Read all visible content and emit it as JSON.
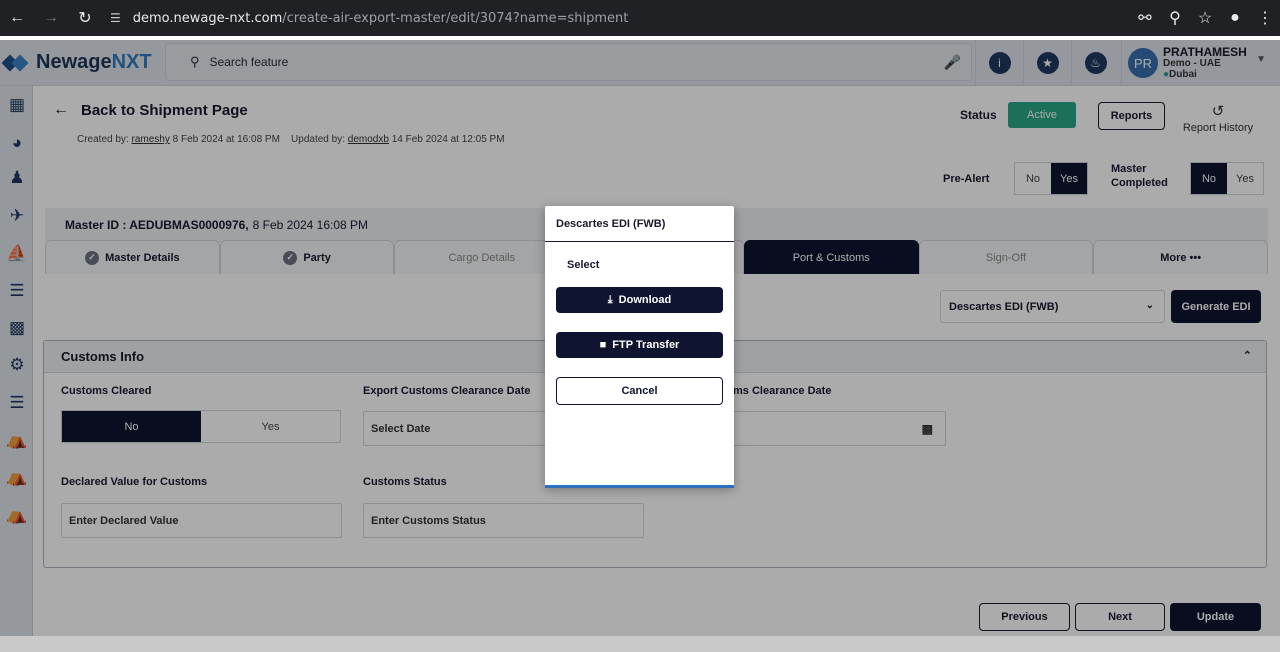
{
  "browser": {
    "host": "demo.newage-nxt.com",
    "path": "/create-air-export-master/edit/3074?name=shipment"
  },
  "app": {
    "brand_a": "Newage",
    "brand_b": "NXT",
    "search_placeholder": "Search feature",
    "user": {
      "initials": "PR",
      "name": "PRATHAMESH",
      "company": "Demo - UAE",
      "location": "Dubai"
    }
  },
  "page": {
    "back_label": "Back to Shipment Page",
    "created_prefix": "Created by:",
    "created_user": "rameshy",
    "created_date": "8 Feb 2024 at 16:08 PM",
    "updated_prefix": "Updated by:",
    "updated_user": "demodxb",
    "updated_date": "14 Feb 2024 at 12:05 PM",
    "status_label": "Status",
    "status_value": "Active",
    "reports_label": "Reports",
    "report_history_label": "Report History",
    "prealert_label": "Pre-Alert",
    "master_completed_label": "Master Completed",
    "no": "No",
    "yes": "Yes",
    "master_id_label": "Master ID : AEDUBMAS0000976,",
    "master_id_date": "8 Feb 2024 16:08 PM"
  },
  "tabs": [
    {
      "label": "Master Details"
    },
    {
      "label": "Party"
    },
    {
      "label": "Cargo Details"
    },
    {
      "label": ""
    },
    {
      "label": "Port & Customs"
    },
    {
      "label": "Sign-Off"
    },
    {
      "label": "More •••"
    }
  ],
  "edi": {
    "selected": "Descartes EDI (FWB)",
    "generate_label": "Generate EDI"
  },
  "customs": {
    "title": "Customs Info",
    "cleared_label": "Customs Cleared",
    "export_date_label": "Export Customs Clearance Date",
    "export_date_placeholder": "Select Date",
    "import_date_label": "ms Clearance Date",
    "declared_label": "Declared Value for Customs",
    "declared_placeholder": "Enter Declared Value",
    "status_label": "Customs Status",
    "status_placeholder": "Enter Customs Status"
  },
  "footer": {
    "previous": "Previous",
    "next": "Next",
    "update": "Update"
  },
  "modal": {
    "title": "Descartes EDI (FWB)",
    "subtitle": "Select",
    "download": "Download",
    "ftp": "FTP Transfer",
    "cancel": "Cancel"
  }
}
